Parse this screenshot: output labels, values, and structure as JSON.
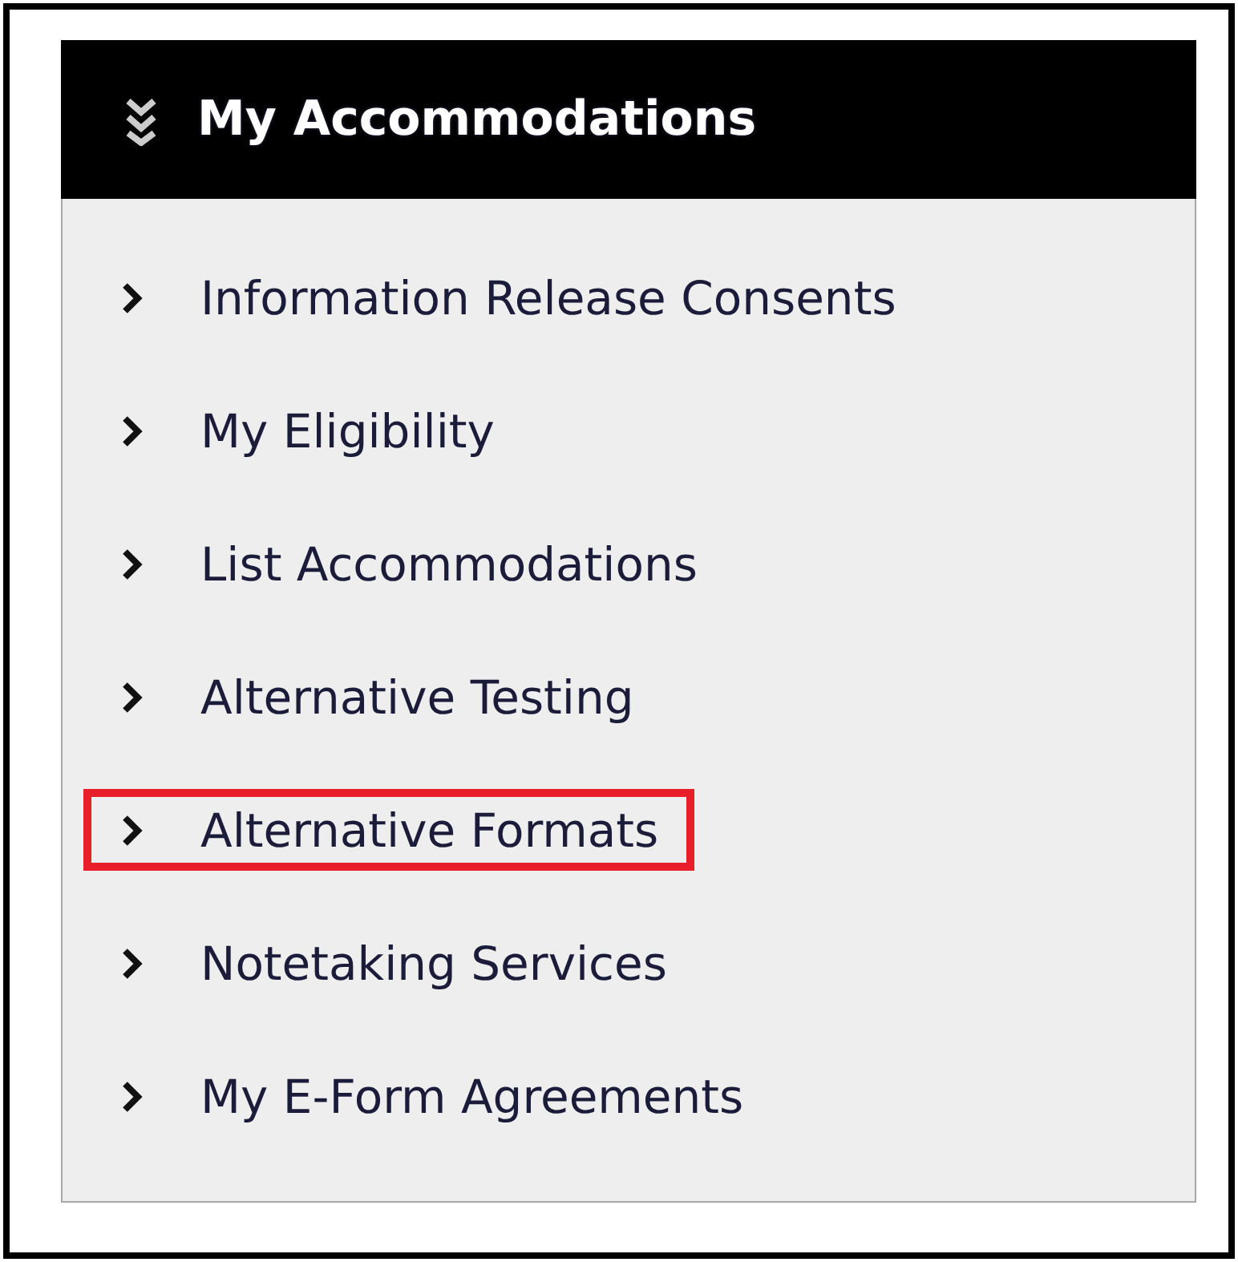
{
  "panel": {
    "title": "My Accommodations",
    "items": [
      {
        "label": "Information Release Consents",
        "highlighted": false
      },
      {
        "label": "My Eligibility",
        "highlighted": false
      },
      {
        "label": "List Accommodations",
        "highlighted": false
      },
      {
        "label": "Alternative Testing",
        "highlighted": false
      },
      {
        "label": "Alternative Formats",
        "highlighted": true
      },
      {
        "label": "Notetaking Services",
        "highlighted": false
      },
      {
        "label": "My E-Form Agreements",
        "highlighted": false
      }
    ]
  }
}
